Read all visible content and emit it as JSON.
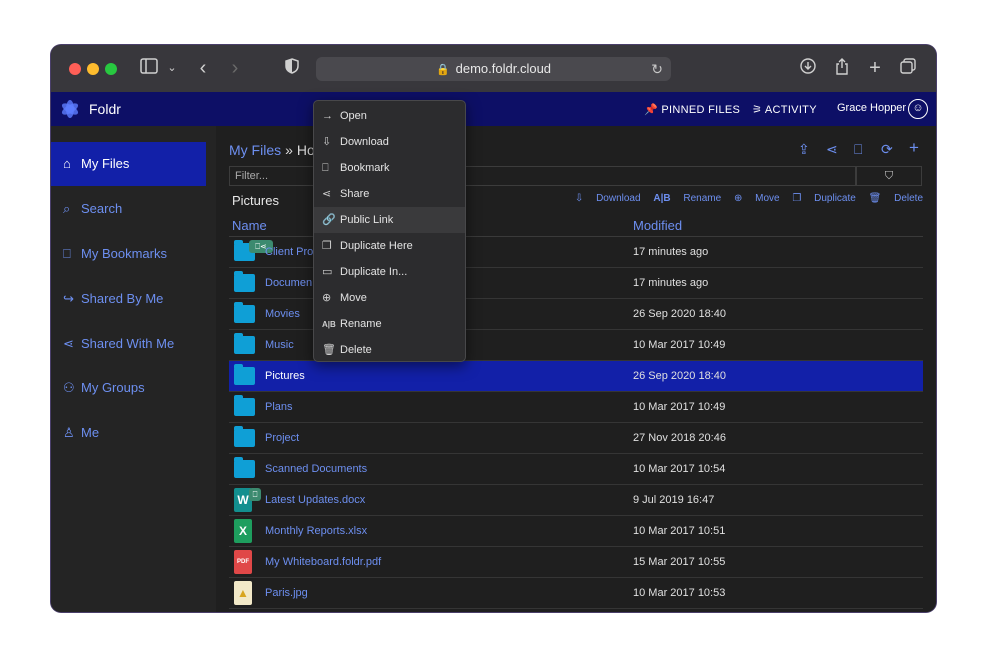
{
  "browser": {
    "url": "demo.foldr.cloud",
    "traffic_lights": [
      "#ff5f57",
      "#febc2e",
      "#28c840"
    ]
  },
  "app": {
    "brand": "Foldr",
    "pinned": "PINNED FILES",
    "activity": "ACTIVITY",
    "user": "Grace Hopper",
    "accent": "#6d8ff0",
    "header_bg": "#0d0f66",
    "selected_bg": "#1220a8"
  },
  "sidebar": {
    "items": [
      {
        "label": "My Files",
        "icon": "home-icon"
      },
      {
        "label": "Search",
        "icon": "search-icon"
      },
      {
        "label": "My Bookmarks",
        "icon": "bookmark-icon"
      },
      {
        "label": "Shared By Me",
        "icon": "share-arrow-icon"
      },
      {
        "label": "Shared With Me",
        "icon": "share-icon"
      },
      {
        "label": "My Groups",
        "icon": "groups-icon"
      },
      {
        "label": "Me",
        "icon": "user-icon"
      }
    ]
  },
  "main": {
    "crumb_root": "My Files",
    "crumb_sep": "»",
    "crumb_current": "Ho",
    "filter_placeholder": "Filter...",
    "folder_title": "Pictures",
    "actions": {
      "download": "Download",
      "rename": "Rename",
      "move": "Move",
      "duplicate": "Duplicate",
      "delete": "Delete"
    },
    "col_name": "Name",
    "col_modified": "Modified",
    "rows": [
      {
        "name": "Client Pro",
        "modified": "17 minutes ago"
      },
      {
        "name": "Documen",
        "modified": "17 minutes ago"
      },
      {
        "name": "Movies",
        "modified": "26 Sep 2020 18:40"
      },
      {
        "name": "Music",
        "modified": "10 Mar 2017 10:49"
      },
      {
        "name": "Pictures",
        "modified": "26 Sep 2020 18:40"
      },
      {
        "name": "Plans",
        "modified": "10 Mar 2017 10:49"
      },
      {
        "name": "Project",
        "modified": "27 Nov 2018 20:46"
      },
      {
        "name": "Scanned Documents",
        "modified": "10 Mar 2017 10:54"
      },
      {
        "name": "Latest Updates.docx",
        "modified": "9 Jul 2019 16:47"
      },
      {
        "name": "Monthly Reports.xlsx",
        "modified": "10 Mar 2017 10:51"
      },
      {
        "name": "My Whiteboard.foldr.pdf",
        "modified": "15 Mar 2017 10:55"
      },
      {
        "name": "Paris.jpg",
        "modified": "10 Mar 2017 10:53"
      }
    ]
  },
  "context_menu": {
    "items": [
      "Open",
      "Download",
      "Bookmark",
      "Share",
      "Public Link",
      "Duplicate Here",
      "Duplicate In...",
      "Move",
      "Rename",
      "Delete"
    ]
  }
}
